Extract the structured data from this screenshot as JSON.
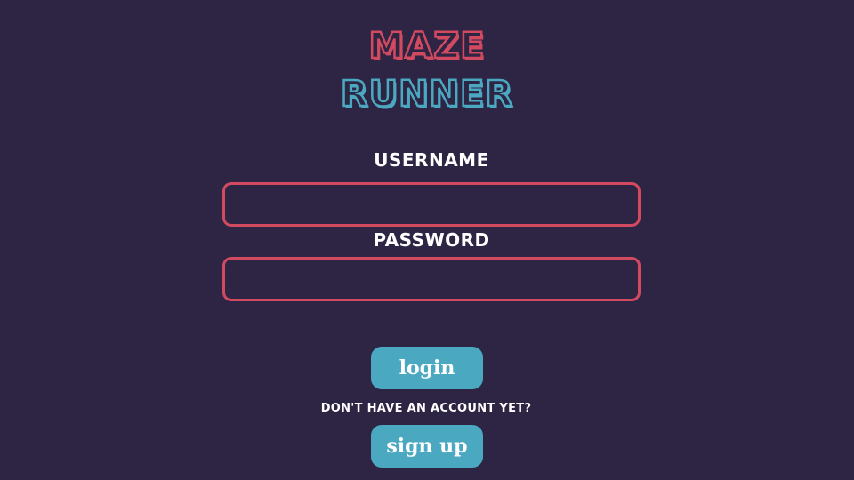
{
  "title": {
    "line1": "MAZE",
    "line2": "RUNNER"
  },
  "form": {
    "username_label": "USERNAME",
    "username_value": "",
    "password_label": "PASSWORD",
    "password_value": ""
  },
  "actions": {
    "login_label": "login",
    "signup_prompt": "DON'T HAVE AN ACCOUNT YET?",
    "signup_label": "sign up"
  },
  "colors": {
    "background": "#2e2444",
    "accent_red": "#d14a60",
    "accent_blue": "#4aa8c0",
    "text": "#ffffff"
  }
}
